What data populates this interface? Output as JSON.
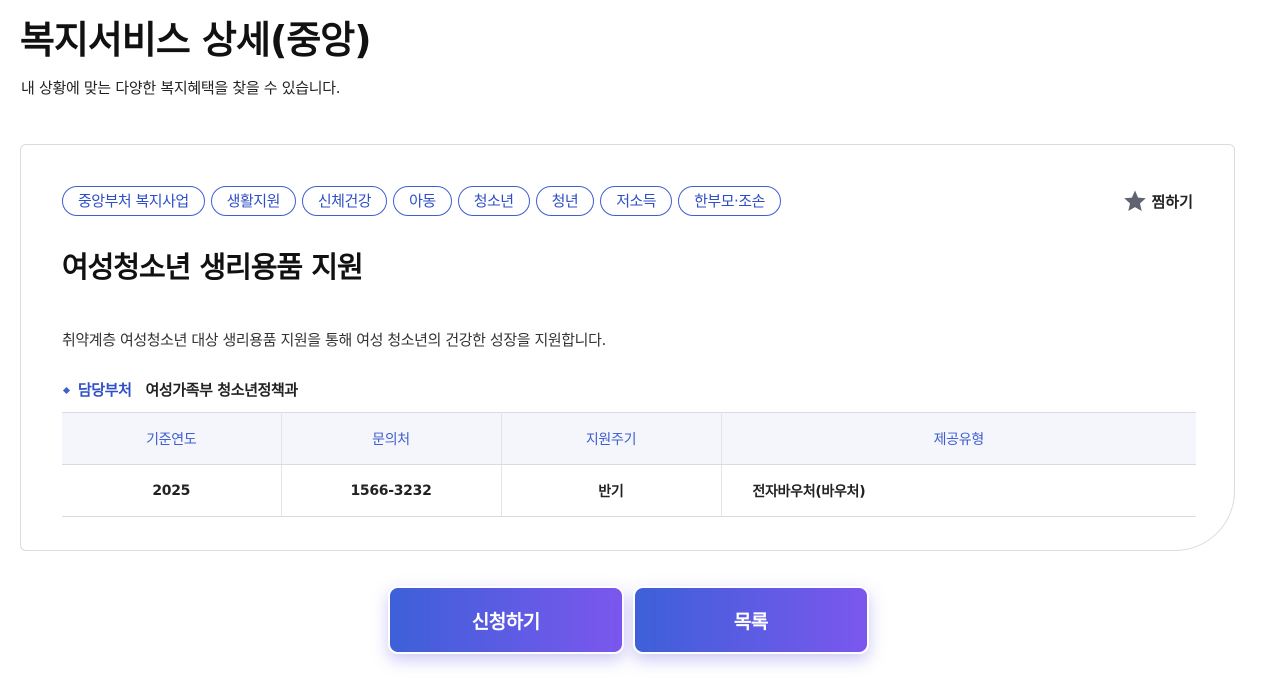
{
  "header": {
    "title": "복지서비스 상세(중앙)",
    "subtitle": "내 상황에 맞는 다양한 복지혜택을 찾을 수 있습니다."
  },
  "card": {
    "tags": [
      "중앙부처 복지사업",
      "생활지원",
      "신체건강",
      "아동",
      "청소년",
      "청년",
      "저소득",
      "한부모·조손"
    ],
    "bookmark": {
      "label": "찜하기",
      "icon": "star-icon"
    },
    "title": "여성청소년 생리용품 지원",
    "description": "취약계층 여성청소년 대상 생리용품 지원을 통해 여성 청소년의 건강한 성장을 지원합니다.",
    "department": {
      "label": "담당부처",
      "value": "여성가족부 청소년정책과"
    },
    "table": {
      "headers": [
        "기준연도",
        "문의처",
        "지원주기",
        "제공유형"
      ],
      "row": [
        "2025",
        "1566-3232",
        "반기",
        "전자바우처(바우처)"
      ]
    }
  },
  "actions": {
    "apply_label": "신청하기",
    "list_label": "목록"
  },
  "colors": {
    "accent": "#3f5ed0",
    "gradient_start": "#3d60d8",
    "gradient_end": "#7b57ee"
  }
}
